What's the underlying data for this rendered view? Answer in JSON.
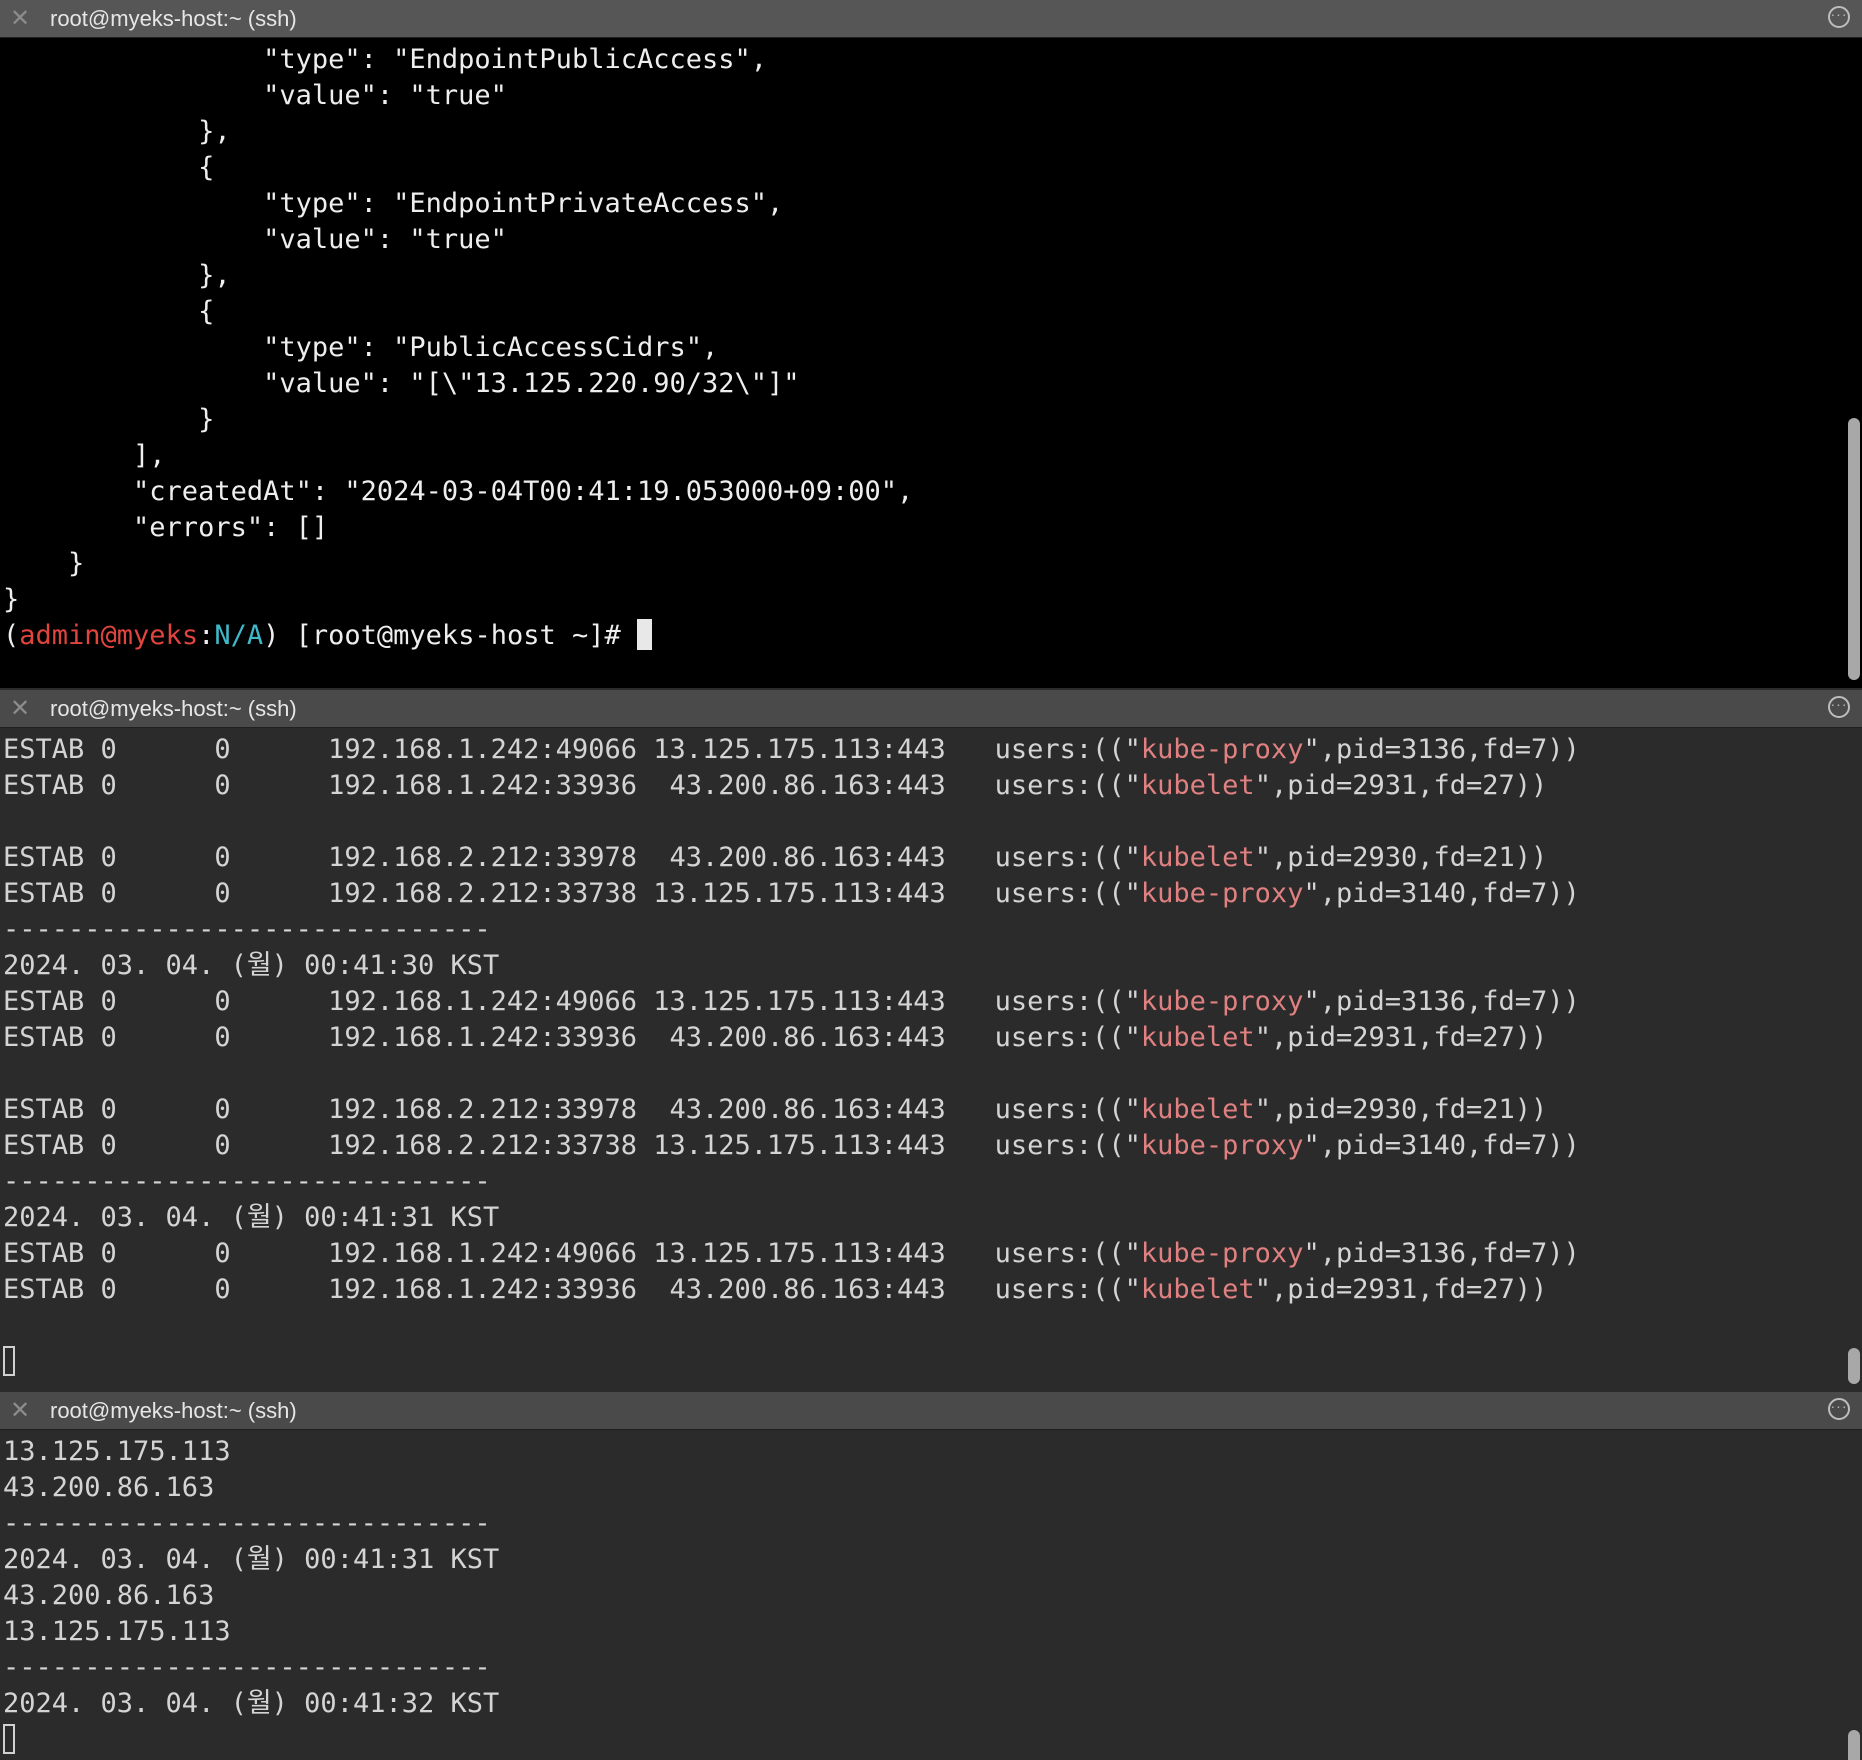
{
  "panes": [
    {
      "title": "root@myeks-host:~ (ssh)",
      "lines": [
        "                \"type\": \"EndpointPublicAccess\",",
        "                \"value\": \"true\"",
        "            },",
        "            {",
        "                \"type\": \"EndpointPrivateAccess\",",
        "                \"value\": \"true\"",
        "            },",
        "            {",
        "                \"type\": \"PublicAccessCidrs\",",
        "                \"value\": \"[\\\"13.125.220.90/32\\\"]\"",
        "            }",
        "        ],",
        "        \"createdAt\": \"2024-03-04T00:41:19.053000+09:00\",",
        "        \"errors\": []",
        "    }",
        "}"
      ],
      "prompt": {
        "open": "(",
        "user": "admin@myeks",
        "sep": ":",
        "ns": "N/A",
        "rest": ") [root@myeks-host ~]# "
      }
    },
    {
      "title": "root@myeks-host:~ (ssh)",
      "lines": [
        {
          "pre": "ESTAB 0      0      192.168.1.242:49066 13.125.175.113:443   users:((\"",
          "proc": "kube-proxy",
          "post": "\",pid=3136,fd=7))"
        },
        {
          "pre": "ESTAB 0      0      192.168.1.242:33936  43.200.86.163:443   users:((\"",
          "proc": "kubelet",
          "post": "\",pid=2931,fd=27))"
        },
        {
          "pre": ""
        },
        {
          "pre": "ESTAB 0      0      192.168.2.212:33978  43.200.86.163:443   users:((\"",
          "proc": "kubelet",
          "post": "\",pid=2930,fd=21))"
        },
        {
          "pre": "ESTAB 0      0      192.168.2.212:33738 13.125.175.113:443   users:((\"",
          "proc": "kube-proxy",
          "post": "\",pid=3140,fd=7))"
        },
        {
          "pre": "------------------------------"
        },
        {
          "pre": "2024. 03. 04. (월) 00:41:30 KST"
        },
        {
          "pre": "ESTAB 0      0      192.168.1.242:49066 13.125.175.113:443   users:((\"",
          "proc": "kube-proxy",
          "post": "\",pid=3136,fd=7))"
        },
        {
          "pre": "ESTAB 0      0      192.168.1.242:33936  43.200.86.163:443   users:((\"",
          "proc": "kubelet",
          "post": "\",pid=2931,fd=27))"
        },
        {
          "pre": ""
        },
        {
          "pre": "ESTAB 0      0      192.168.2.212:33978  43.200.86.163:443   users:((\"",
          "proc": "kubelet",
          "post": "\",pid=2930,fd=21))"
        },
        {
          "pre": "ESTAB 0      0      192.168.2.212:33738 13.125.175.113:443   users:((\"",
          "proc": "kube-proxy",
          "post": "\",pid=3140,fd=7))"
        },
        {
          "pre": "------------------------------"
        },
        {
          "pre": "2024. 03. 04. (월) 00:41:31 KST"
        },
        {
          "pre": "ESTAB 0      0      192.168.1.242:49066 13.125.175.113:443   users:((\"",
          "proc": "kube-proxy",
          "post": "\",pid=3136,fd=7))"
        },
        {
          "pre": "ESTAB 0      0      192.168.1.242:33936  43.200.86.163:443   users:((\"",
          "proc": "kubelet",
          "post": "\",pid=2931,fd=27))"
        },
        {
          "pre": ""
        }
      ]
    },
    {
      "title": "root@myeks-host:~ (ssh)",
      "lines": [
        "13.125.175.113",
        "43.200.86.163",
        "------------------------------",
        "2024. 03. 04. (월) 00:41:31 KST",
        "43.200.86.163",
        "13.125.175.113",
        "------------------------------",
        "2024. 03. 04. (월) 00:41:32 KST"
      ]
    }
  ],
  "colors": {
    "process_name": "#e08080",
    "prompt_user": "#e0443e",
    "prompt_ns": "#3fb8c8"
  }
}
